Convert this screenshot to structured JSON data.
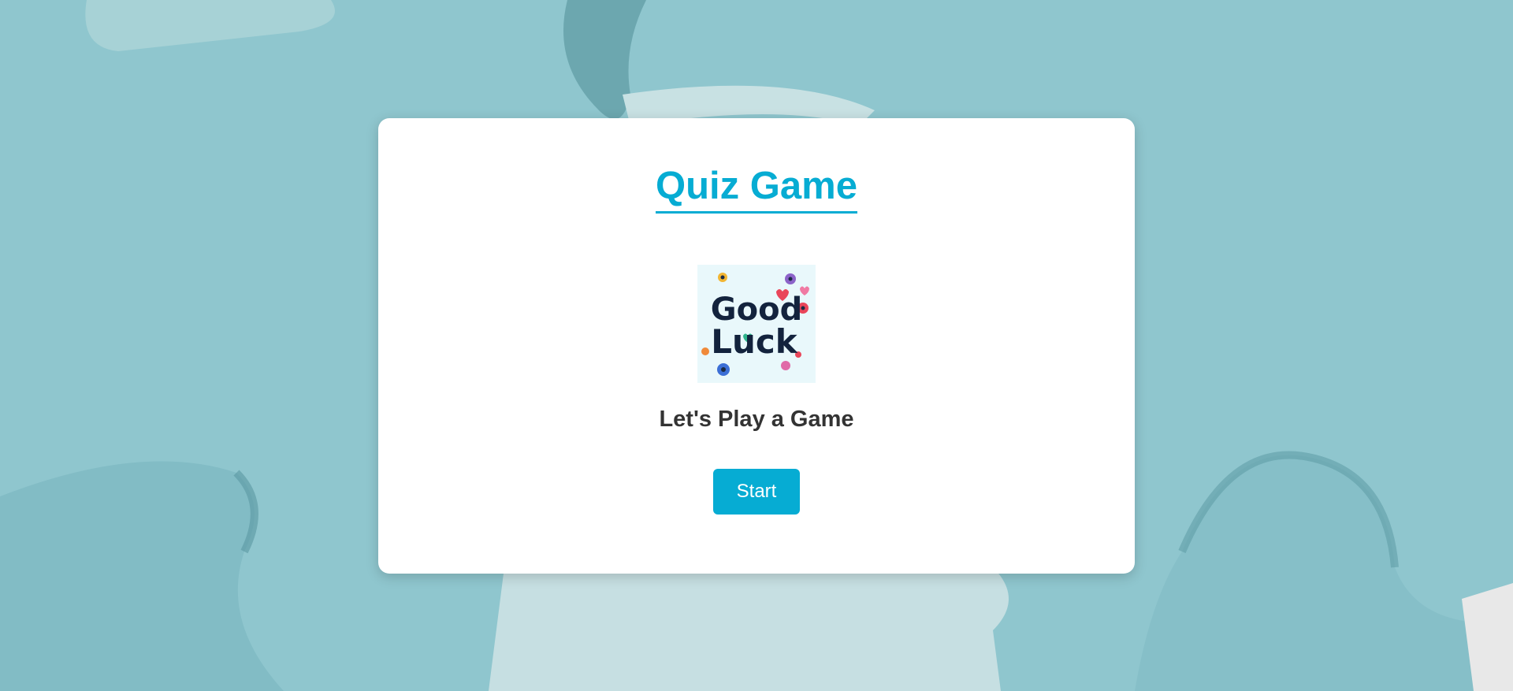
{
  "game": {
    "title": "Quiz Game",
    "logo_name": "good-luck-logo",
    "logo_text_line1": "Good",
    "logo_text_line2": "Luck",
    "subtitle": "Let's Play a Game",
    "start_label": "Start"
  },
  "colors": {
    "accent": "#06acd3",
    "text": "#333333",
    "card": "#ffffff",
    "background": "#8cc4cc"
  }
}
